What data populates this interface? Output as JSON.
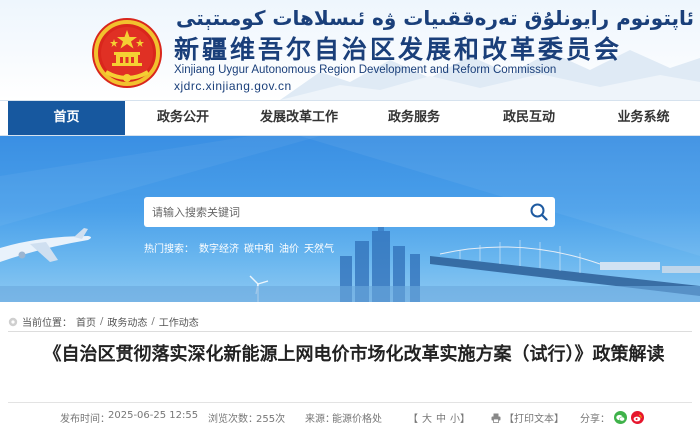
{
  "header": {
    "uyghur_title": "شىنجاڭ ئۇيغۇر ئاپتونوم رايونلۇق تەرەققىيات ۋە ئىسلاھات كومىتېتى",
    "cn_title": "新疆维吾尔自治区发展和改革委员会",
    "en_title": "Xinjiang Uygur Autonomous Region Development and Reform Commission",
    "domain": "xjdrc.xinjiang.gov.cn"
  },
  "nav": {
    "items": [
      {
        "label": "首页",
        "active": true
      },
      {
        "label": "政务公开"
      },
      {
        "label": "发展改革工作"
      },
      {
        "label": "政务服务"
      },
      {
        "label": "政民互动"
      },
      {
        "label": "业务系统"
      }
    ]
  },
  "search": {
    "placeholder": "请输入搜索关键词",
    "hot_label": "热门搜索：",
    "hot_keywords": [
      "数字经济",
      "碳中和",
      "油价",
      "天然气"
    ]
  },
  "breadcrumb": {
    "label": "当前位置：",
    "items": [
      "首页",
      "政务动态",
      "工作动态"
    ]
  },
  "article": {
    "title": "《自治区贯彻落实深化新能源上网电价市场化改革实施方案（试行）》政策解读",
    "publish_label": "发布时间：",
    "publish_time": "2025-06-25 12:55",
    "views_label": "浏览次数：",
    "views": "255次",
    "source_label": "来源：",
    "source": "能源价格处",
    "font_size_options": [
      "【",
      "大",
      "中",
      "小",
      "】"
    ],
    "print_label": "【打印文本】",
    "share_label": "分享："
  },
  "colors": {
    "brand_blue": "#17589f",
    "header_text": "#1a3f7a",
    "wechat": "#3fb24a",
    "weibo": "#e6162d"
  }
}
